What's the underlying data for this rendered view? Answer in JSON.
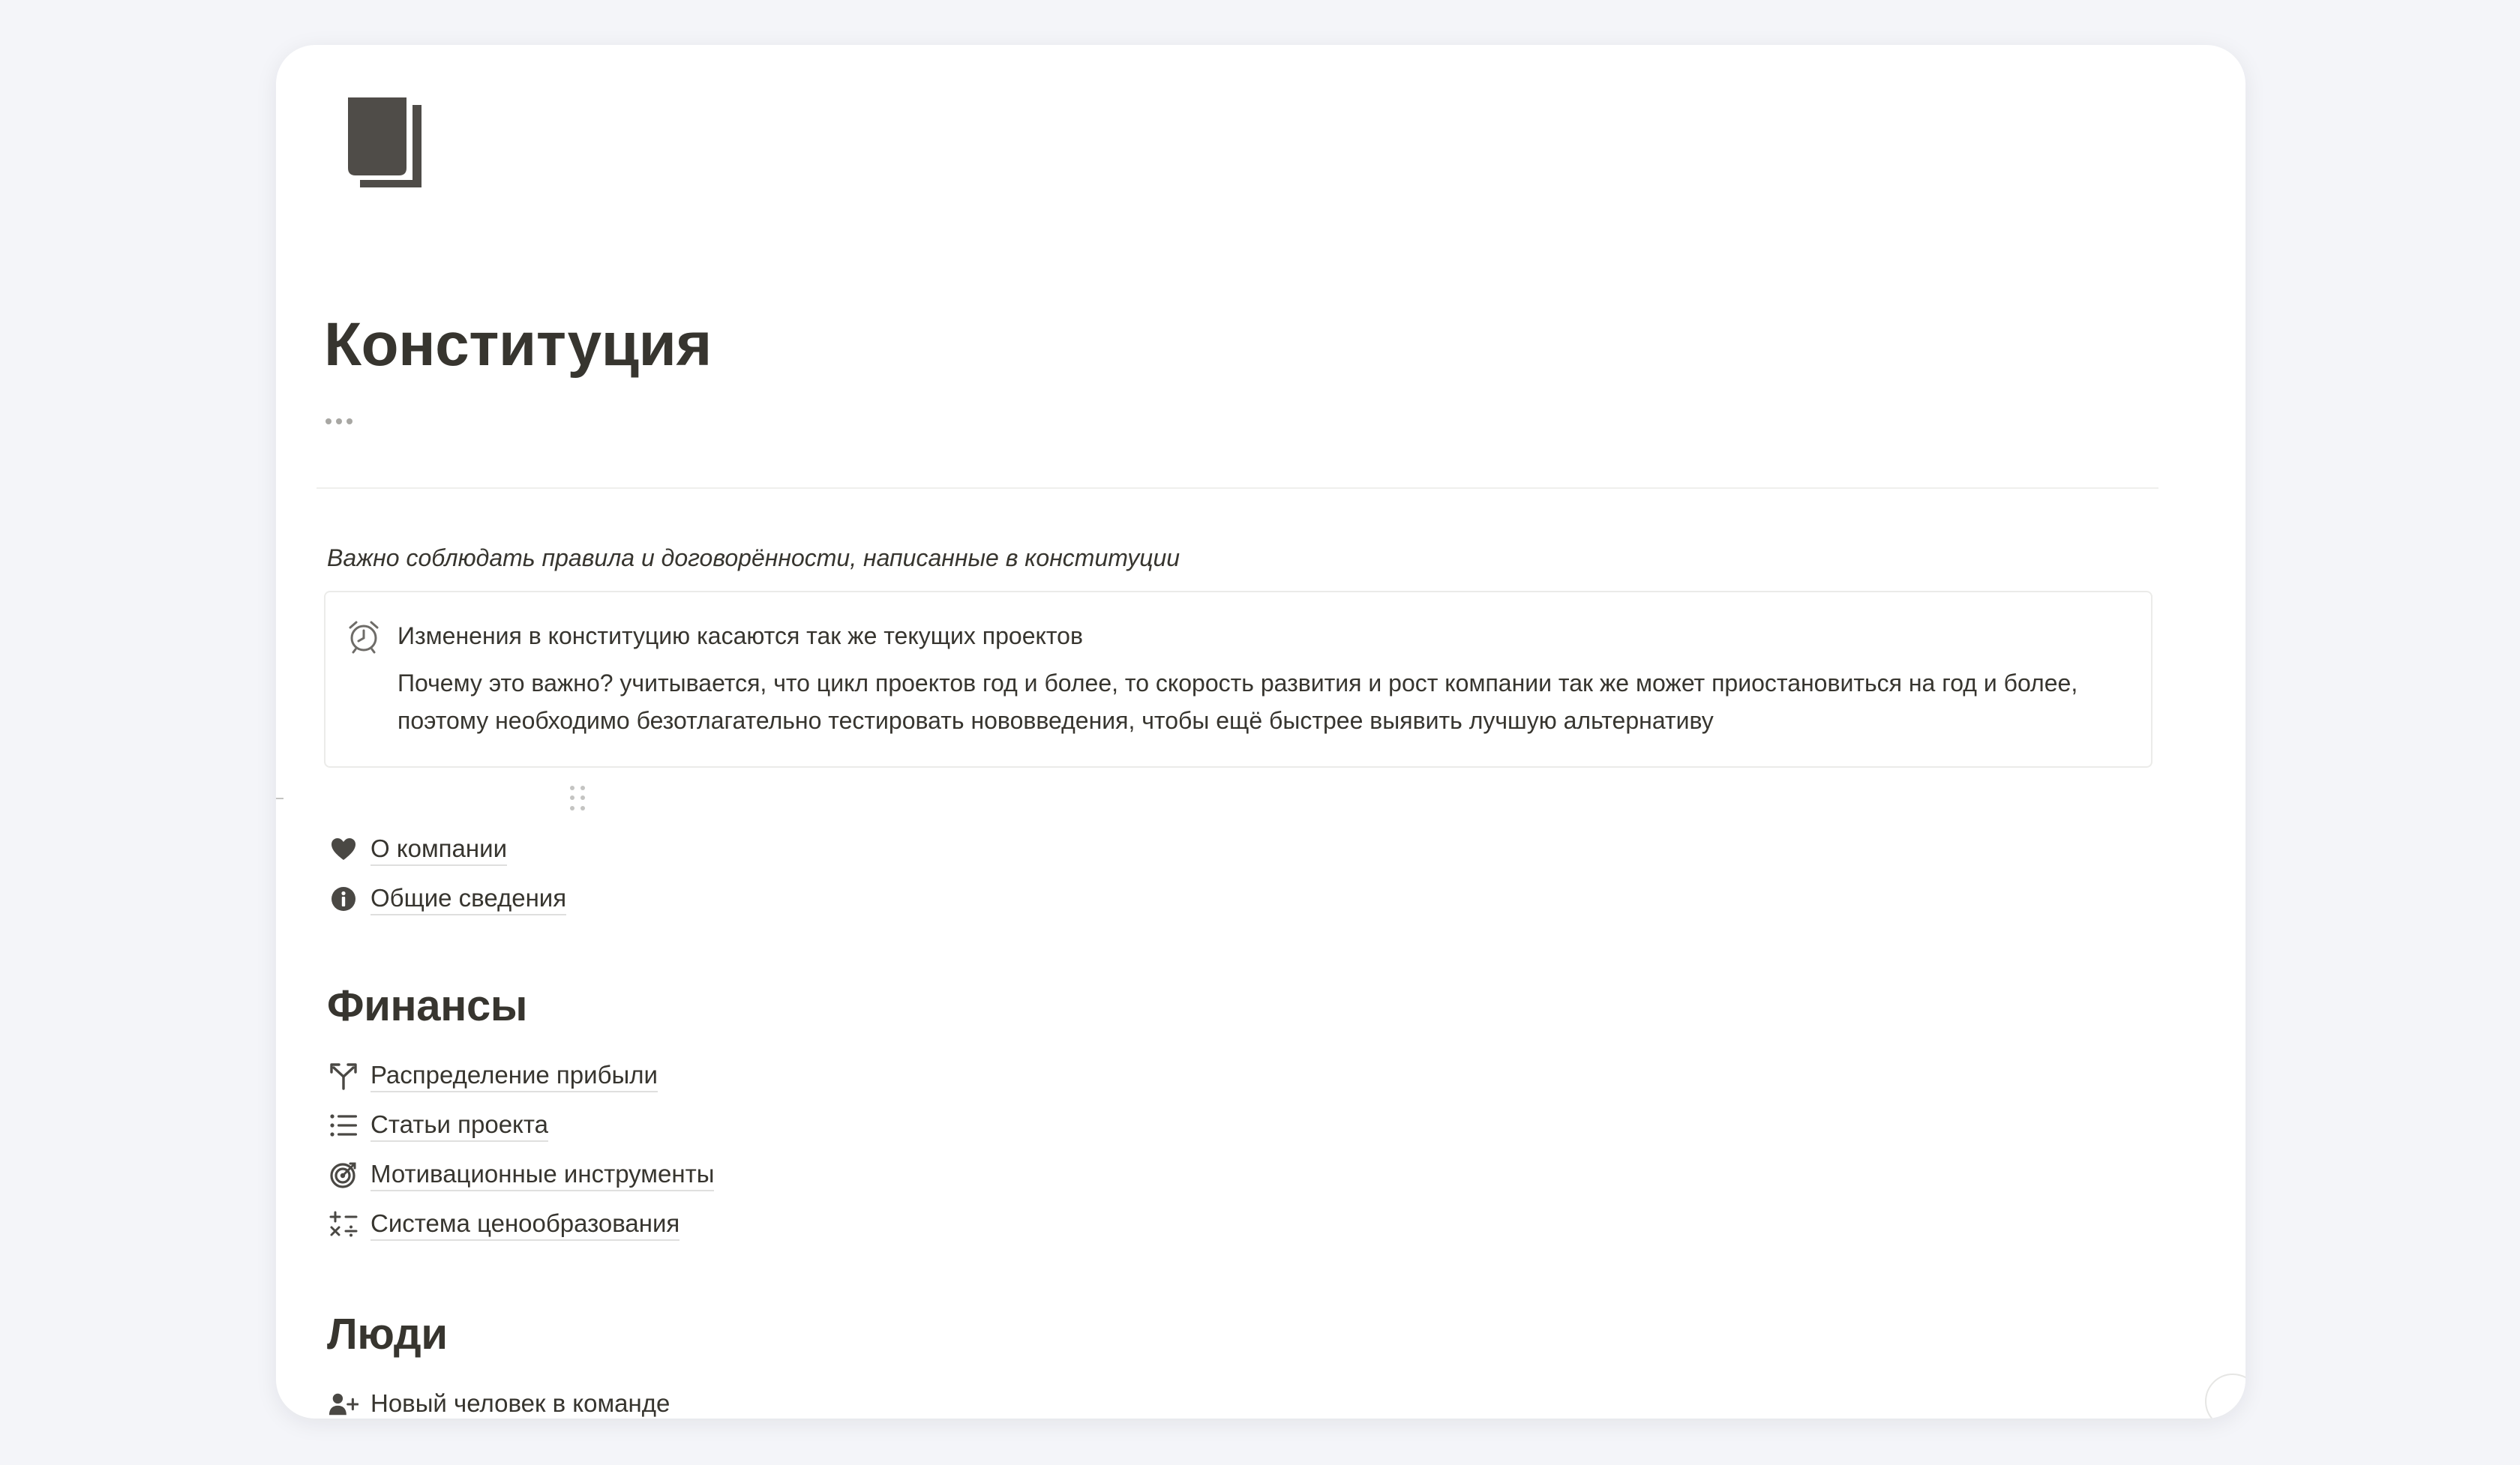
{
  "page": {
    "title": "Конституция",
    "more_icon": "ellipsis-icon",
    "page_icon": "documents-icon"
  },
  "intro": {
    "text": "Важно соблюдать правила и договорённости, написанные в конституции"
  },
  "callout": {
    "icon": "alarm-clock-icon",
    "title": "Изменения в конституцию касаются так же текущих проектов",
    "body": "Почему это важно? учитывается, что цикл проектов год и более, то скорость развития и рост компании так же может приостановиться на год и более, поэтому необходимо безотлагательно тестировать нововведения, чтобы ещё быстрее выявить лучшую альтернативу"
  },
  "general_links": [
    {
      "label": "О компании",
      "icon": "heart-icon"
    },
    {
      "label": "Общие сведения",
      "icon": "info-icon"
    }
  ],
  "finance": {
    "heading": "Финансы",
    "links": [
      {
        "label": "Распределение прибыли",
        "icon": "split-arrows-icon"
      },
      {
        "label": "Статьи проекта",
        "icon": "list-icon"
      },
      {
        "label": "Мотивационные инструменты",
        "icon": "target-icon"
      },
      {
        "label": "Система ценообразования",
        "icon": "calculator-icon"
      }
    ]
  },
  "people": {
    "heading": "Люди",
    "links": [
      {
        "label": "Новый человек в команде",
        "icon": "add-user-icon"
      }
    ]
  },
  "colors": {
    "background": "#f4f5f9",
    "card": "#ffffff",
    "text": "#37352f",
    "icon": "#4a4844",
    "border": "#ebebe9"
  }
}
